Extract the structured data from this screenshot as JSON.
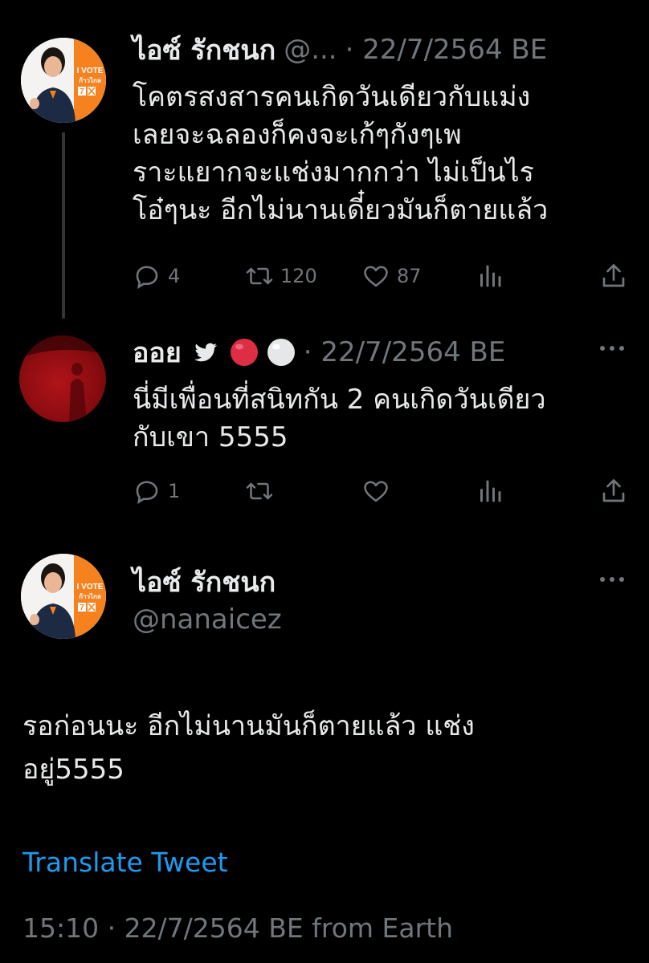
{
  "tweet1": {
    "name": "ไอซ์ รักชนก",
    "handle": "@...",
    "date": "· 22/7/2564 BE",
    "lines": [
      "โคตรสงสารคนเกิดวันเดียวกับแม่ง",
      "เลยจะฉลองก็คงจะเก้ๆกังๆเพ",
      "ราะแยากจะแช่งมากกว่า ไม่เป็นไร",
      "โอ๋ๆนะ อีกไม่นานเดี๋ยวมันก็ตายแล้ว"
    ],
    "replies": "4",
    "retweets": "120",
    "likes": "87"
  },
  "tweet2": {
    "name": "ออย",
    "date": "· 22/7/2564 BE",
    "lines": [
      "นี่มีเพื่อนที่สนิทกัน 2 คนเกิดวันเดียว",
      "กับเขา 5555"
    ],
    "replies": "1"
  },
  "main": {
    "name": "ไอซ์ รักชนก",
    "handle": "@nanaicez",
    "lines": [
      "รอก่อนนะ อีกไม่นานมันก็ตายแล้ว แช่ง",
      "อยู่5555"
    ],
    "translate": "Translate Tweet",
    "timestamp": "15:10 · 22/7/2564 BE from Earth"
  },
  "avatar1": {
    "vote_text": "I VOTE",
    "party_text": "ก้าวไกล",
    "number": "7"
  },
  "colors": {
    "background": "#000000",
    "text": "#e7e9ea",
    "muted": "#71767b",
    "link": "#1d9bf0",
    "orange": "#f5821f"
  },
  "icons": [
    "reply-icon",
    "retweet-icon",
    "like-icon",
    "views-icon",
    "share-icon",
    "more-icon",
    "bird-icon",
    "red-circle-icon",
    "white-circle-icon"
  ]
}
